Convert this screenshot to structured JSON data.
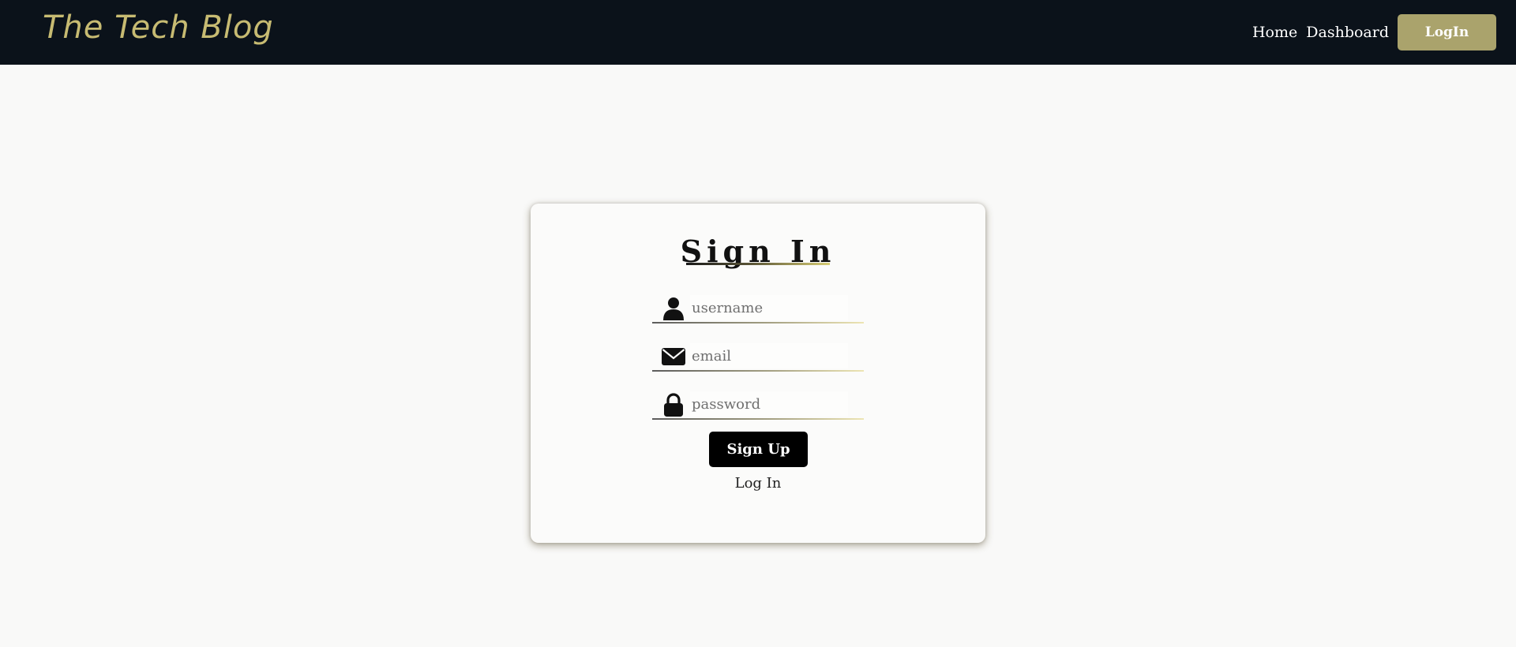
{
  "navbar": {
    "brand": "The Tech Blog",
    "links": {
      "home": "Home",
      "dashboard": "Dashboard"
    },
    "login_button": "LogIn"
  },
  "form": {
    "title": "Sign In",
    "username": {
      "placeholder": "username",
      "value": "",
      "icon": "user-icon"
    },
    "email": {
      "placeholder": "email",
      "value": "",
      "icon": "envelope-icon"
    },
    "password": {
      "placeholder": "password",
      "value": "",
      "icon": "lock-icon"
    },
    "submit_label": "Sign Up",
    "alt_link": "Log In"
  },
  "colors": {
    "navbar_bg": "#0b121a",
    "brand": "#c7bb72",
    "accent_button": "#aaa36c",
    "primary_button": "#000000",
    "page_bg": "#f9f9f8"
  }
}
